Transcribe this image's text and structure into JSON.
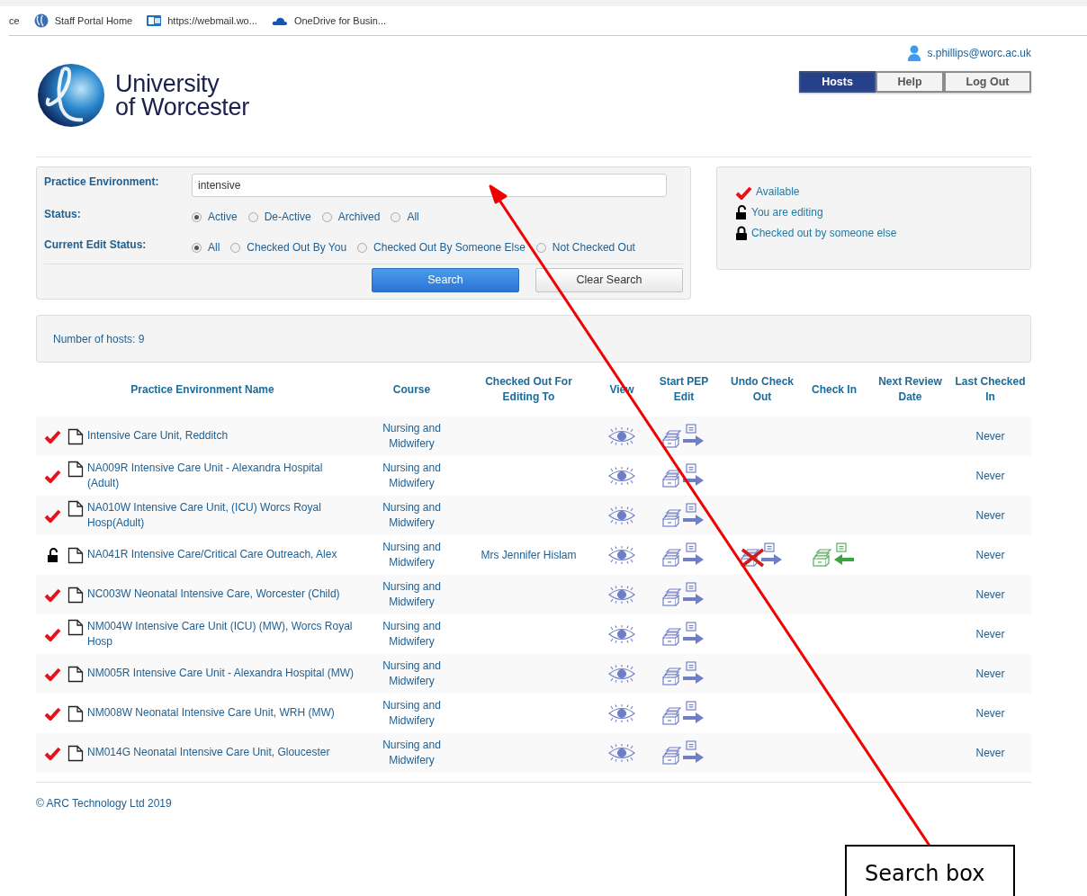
{
  "bookmarks": [
    {
      "label": "ce",
      "kind": "none"
    },
    {
      "label": "Staff Portal Home",
      "kind": "globe"
    },
    {
      "label": "https://webmail.wo...",
      "kind": "mail"
    },
    {
      "label": "OneDrive for Busin...",
      "kind": "cloud"
    }
  ],
  "logo": {
    "line_1": "University",
    "line_2": "of Worcester"
  },
  "user": {
    "email": "s.phillips@worc.ac.uk"
  },
  "nav": [
    {
      "label": "Hosts",
      "selected": true
    },
    {
      "label": "Help",
      "selected": false
    },
    {
      "label": "Log Out",
      "selected": false
    }
  ],
  "search": {
    "practice_environment": {
      "label": "Practice Environment:",
      "value": "intensive"
    },
    "status": {
      "label": "Status:",
      "options": [
        {
          "label": "Active",
          "selected": true
        },
        {
          "label": "De-Active",
          "selected": false
        },
        {
          "label": "Archived",
          "selected": false
        },
        {
          "label": "All",
          "selected": false
        }
      ]
    },
    "edit_status": {
      "label": "Current Edit Status:",
      "options": [
        {
          "label": "All",
          "selected": true
        },
        {
          "label": "Checked Out By You",
          "selected": false
        },
        {
          "label": "Checked Out By Someone Else",
          "selected": false
        },
        {
          "label": "Not Checked Out",
          "selected": false
        }
      ]
    },
    "buttons": [
      {
        "label": "Search",
        "kind": "primary"
      },
      {
        "label": "Clear Search",
        "kind": "secondary"
      }
    ]
  },
  "legend": [
    {
      "kind": "available",
      "label": "Available"
    },
    {
      "kind": "editing",
      "label": "You are editing"
    },
    {
      "kind": "locked",
      "label": "Checked out by someone else"
    }
  ],
  "host_count": "Number of hosts: 9",
  "table": {
    "columns": [
      "Practice Environment Name",
      "Course",
      "Checked Out For Editing To",
      "View",
      "Start PEP Edit",
      "Undo Check Out",
      "Check In",
      "Next Review Date",
      "Last Checked In"
    ],
    "rows": [
      {
        "kind": "available",
        "name": "Intensive Care Unit, Redditch",
        "course": "Nursing and Midwifery",
        "undo_check_out": false,
        "check_in": false,
        "last_checked_in": "Never"
      },
      {
        "kind": "available",
        "name": "NA009R Intensive Care Unit - Alexandra Hospital (Adult)",
        "course": "Nursing and Midwifery",
        "undo_check_out": false,
        "check_in": false,
        "last_checked_in": "Never"
      },
      {
        "kind": "available",
        "name": "NA010W Intensive Care Unit, (ICU) Worcs Royal Hosp(Adult)",
        "course": "Nursing and Midwifery",
        "undo_check_out": false,
        "check_in": false,
        "last_checked_in": "Never"
      },
      {
        "kind": "editing",
        "name": "NA041R Intensive Care/Critical Care Outreach, Alex",
        "course": "Nursing and Midwifery",
        "checked_out_to": "Mrs Jennifer Hislam",
        "undo_check_out": true,
        "check_in": true,
        "last_checked_in": "Never"
      },
      {
        "kind": "available",
        "name": "NC003W Neonatal Intensive Care, Worcester (Child)",
        "course": "Nursing and Midwifery",
        "undo_check_out": false,
        "check_in": false,
        "last_checked_in": "Never"
      },
      {
        "kind": "available",
        "name": "NM004W Intensive Care Unit (ICU) (MW), Worcs Royal Hosp",
        "course": "Nursing and Midwifery",
        "undo_check_out": false,
        "check_in": false,
        "last_checked_in": "Never"
      },
      {
        "kind": "available",
        "name": "NM005R Intensive Care Unit - Alexandra Hospital (MW)",
        "course": "Nursing and Midwifery",
        "undo_check_out": false,
        "check_in": false,
        "last_checked_in": "Never"
      },
      {
        "kind": "available",
        "name": "NM008W Neonatal Intensive Care Unit, WRH (MW)",
        "course": "Nursing and Midwifery",
        "undo_check_out": false,
        "check_in": false,
        "last_checked_in": "Never"
      },
      {
        "kind": "available",
        "name": "NM014G Neonatal Intensive Care Unit, Gloucester",
        "course": "Nursing and Midwifery",
        "undo_check_out": false,
        "check_in": false,
        "last_checked_in": "Never"
      }
    ]
  },
  "footer": "© ARC Technology Ltd 2019",
  "annotation": {
    "label": "Search box"
  }
}
